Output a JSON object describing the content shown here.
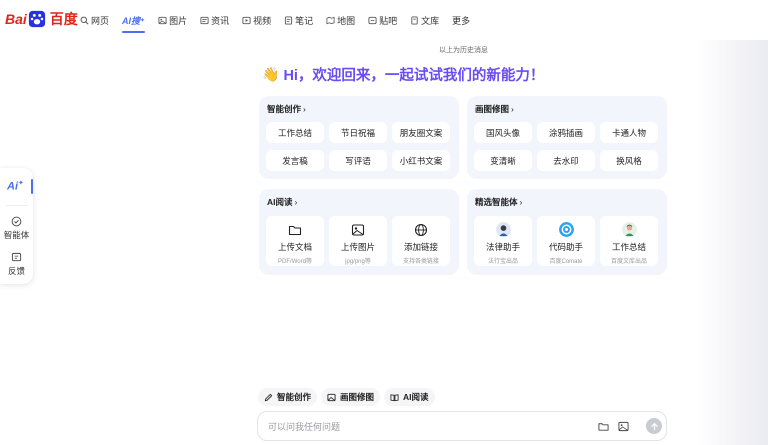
{
  "logo": {
    "left": "Bai",
    "right": "百度"
  },
  "nav": [
    {
      "label": "网页",
      "icon": "search-icon"
    },
    {
      "label": "AI搜",
      "icon": "ai-icon",
      "active": true
    },
    {
      "label": "图片",
      "icon": "image-icon"
    },
    {
      "label": "资讯",
      "icon": "news-icon"
    },
    {
      "label": "视频",
      "icon": "video-icon"
    },
    {
      "label": "笔记",
      "icon": "note-icon"
    },
    {
      "label": "地图",
      "icon": "map-icon"
    },
    {
      "label": "贴吧",
      "icon": "tieba-icon"
    },
    {
      "label": "文库",
      "icon": "library-icon"
    },
    {
      "label": "更多",
      "icon": ""
    }
  ],
  "side": {
    "ai_label": "Ai",
    "agents_label": "智能体",
    "feedback_label": "反馈"
  },
  "history_hint": "以上为历史消息",
  "greeting": {
    "emoji": "👋",
    "text": "Hi，欢迎回来，一起试试我们的新能力！"
  },
  "cards": {
    "creation": {
      "title": "智能创作",
      "chips": [
        "工作总结",
        "节日祝福",
        "朋友圈文案",
        "发言稿",
        "写评语",
        "小红书文案"
      ]
    },
    "image_edit": {
      "title": "画图修图",
      "chips": [
        "国风头像",
        "涂鸦插画",
        "卡通人物",
        "变清晰",
        "去水印",
        "换风格"
      ]
    },
    "ai_read": {
      "title": "AI阅读",
      "tiles": [
        {
          "label": "上传文档",
          "sub": "PDF/Word等",
          "icon": "folder-icon"
        },
        {
          "label": "上传图片",
          "sub": "jpg/png等",
          "icon": "image-icon"
        },
        {
          "label": "添加链接",
          "sub": "支持各类链接",
          "icon": "globe-icon"
        }
      ]
    },
    "agents": {
      "title": "精选智能体",
      "tiles": [
        {
          "label": "法律助手",
          "sub": "法行宝出品",
          "icon": "lawyer-avatar-icon"
        },
        {
          "label": "代码助手",
          "sub": "百度Comate",
          "icon": "comate-avatar-icon"
        },
        {
          "label": "工作总结",
          "sub": "百度文库出品",
          "icon": "worker-avatar-icon"
        }
      ]
    }
  },
  "chevron": "›",
  "quick_actions": [
    {
      "label": "智能创作",
      "icon": "pen-icon"
    },
    {
      "label": "画图修图",
      "icon": "picture-icon"
    },
    {
      "label": "AI阅读",
      "icon": "book-icon"
    }
  ],
  "input": {
    "placeholder": "可以问我任何问题",
    "value": ""
  },
  "colors": {
    "brand": "#4e6ef2",
    "greeting": "#6a4cf2",
    "card_bg": "#f3f5fc",
    "baidu_red": "#e1251b"
  }
}
